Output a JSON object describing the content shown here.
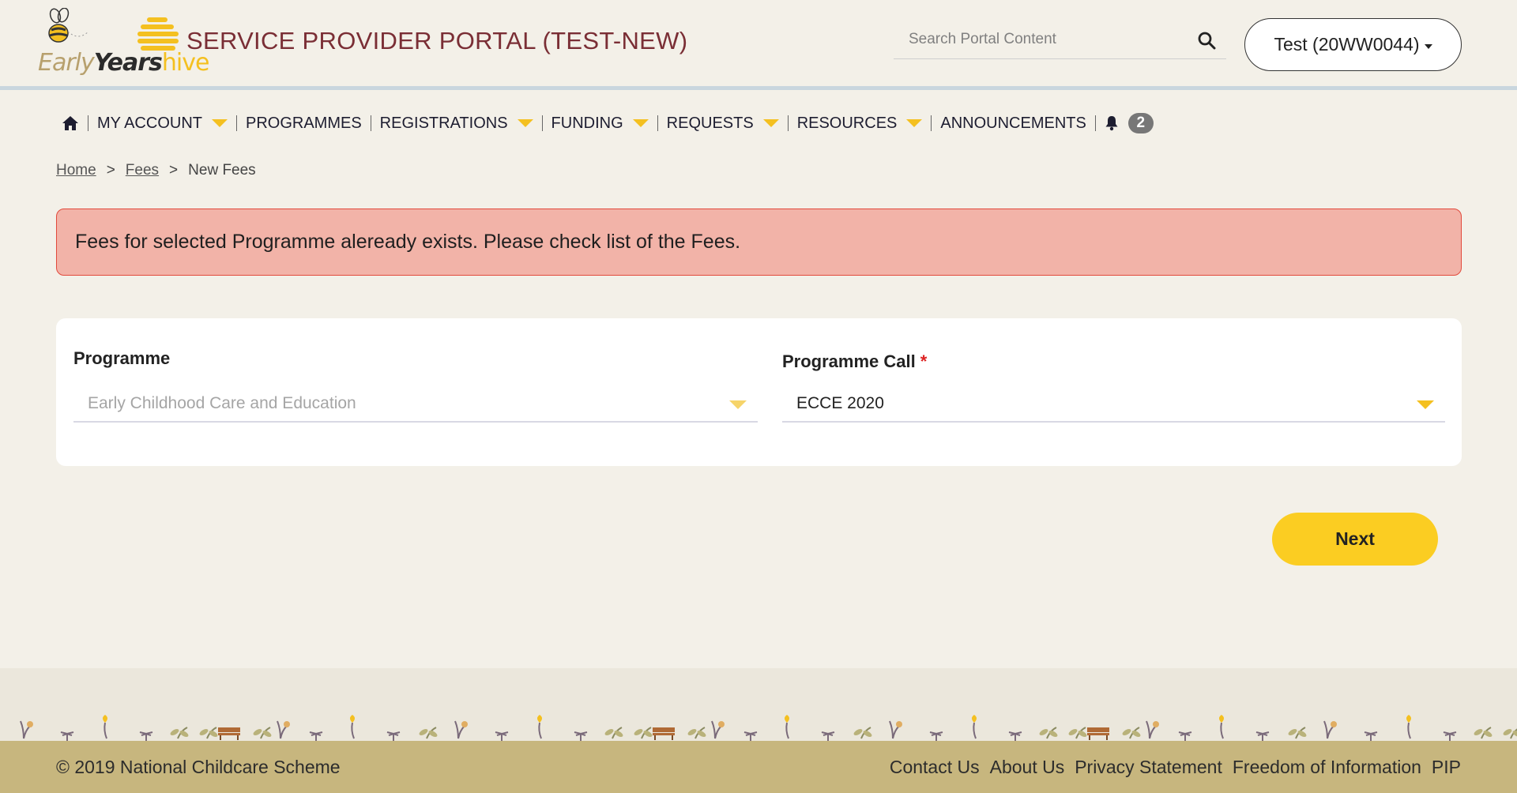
{
  "header": {
    "logo": {
      "early": "Early",
      "years": "Years",
      "hive": "hive"
    },
    "portal_title": "SERVICE PROVIDER PORTAL (TEST-NEW)",
    "search_placeholder": "Search Portal Content",
    "account_label": "Test (20WW0044)"
  },
  "nav": {
    "home_icon": "home-icon",
    "items": [
      {
        "label": "MY ACCOUNT",
        "has_dropdown": true
      },
      {
        "label": "PROGRAMMES",
        "has_dropdown": false
      },
      {
        "label": "REGISTRATIONS",
        "has_dropdown": true
      },
      {
        "label": "FUNDING",
        "has_dropdown": true
      },
      {
        "label": "REQUESTS",
        "has_dropdown": true
      },
      {
        "label": "RESOURCES",
        "has_dropdown": true
      },
      {
        "label": "ANNOUNCEMENTS",
        "has_dropdown": false
      }
    ],
    "notifications_icon": "bell-icon",
    "notification_count": "2"
  },
  "breadcrumb": {
    "items": [
      "Home",
      "Fees"
    ],
    "current": "New Fees",
    "separator": ">"
  },
  "alert": {
    "message": "Fees for selected Programme aleready exists. Please check list of the Fees."
  },
  "form": {
    "programme": {
      "label": "Programme",
      "value": "Early Childhood Care and Education",
      "disabled": true
    },
    "programme_call": {
      "label": "Programme Call",
      "required_marker": "*",
      "value": "ECCE 2020"
    }
  },
  "actions": {
    "next_label": "Next"
  },
  "footer": {
    "copyright": "© 2019 National Childcare Scheme",
    "links": [
      "Contact Us",
      "About Us",
      "Privacy Statement",
      "Freedom of Information",
      "PIP"
    ]
  },
  "colors": {
    "accent_yellow": "#fbcd22",
    "title_maroon": "#7a2e35",
    "alert_bg": "#f2b3a8",
    "alert_border": "#e24a3c",
    "footer_bg": "#c7b67e",
    "page_bg": "#f3f0e8"
  }
}
